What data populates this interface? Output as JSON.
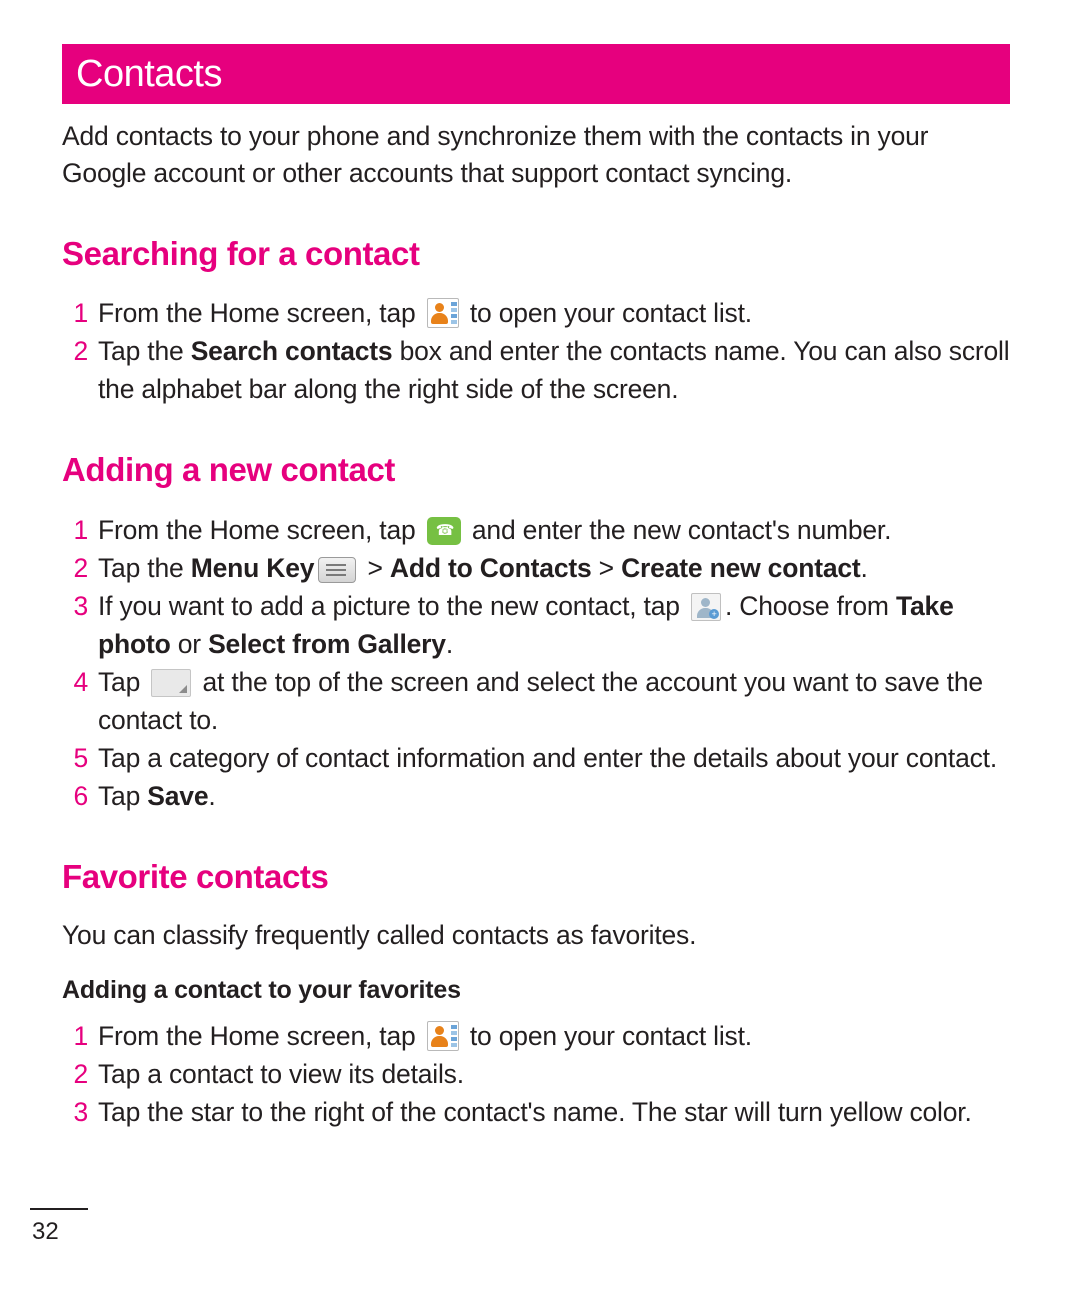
{
  "header": {
    "title": "Contacts",
    "accent_color": "#e6007e"
  },
  "intro": "Add contacts to your phone and synchronize them with the contacts in your Google account or other accounts that support contact syncing.",
  "sections": [
    {
      "heading": "Searching for a contact",
      "steps": [
        {
          "num": "1",
          "parts": [
            {
              "text": "From the Home screen, tap "
            },
            {
              "icon": "contacts-icon"
            },
            {
              "text": " to open your contact list."
            }
          ]
        },
        {
          "num": "2",
          "parts": [
            {
              "text": "Tap the "
            },
            {
              "text": "Search contacts",
              "bold": true
            },
            {
              "text": " box and enter the contacts name. You can also scroll the alphabet bar along the right side of the screen."
            }
          ]
        }
      ]
    },
    {
      "heading": "Adding a new contact",
      "steps": [
        {
          "num": "1",
          "parts": [
            {
              "text": "From the Home screen, tap "
            },
            {
              "icon": "phone-dial-icon"
            },
            {
              "text": " and enter the new contact's number."
            }
          ]
        },
        {
          "num": "2",
          "parts": [
            {
              "text": "Tap the "
            },
            {
              "text": "Menu Key",
              "bold": true
            },
            {
              "icon": "menu-key-icon"
            },
            {
              "text": " > "
            },
            {
              "text": "Add to Contacts",
              "bold": true
            },
            {
              "text": " > "
            },
            {
              "text": "Create new contact",
              "bold": true
            },
            {
              "text": "."
            }
          ]
        },
        {
          "num": "3",
          "parts": [
            {
              "text": "If you want to add a picture to the new contact, tap "
            },
            {
              "icon": "add-photo-icon"
            },
            {
              "text": ". Choose from "
            },
            {
              "text": "Take photo",
              "bold": true
            },
            {
              "text": " or "
            },
            {
              "text": "Select from Gallery",
              "bold": true
            },
            {
              "text": "."
            }
          ]
        },
        {
          "num": "4",
          "parts": [
            {
              "text": "Tap "
            },
            {
              "icon": "account-dropdown-icon"
            },
            {
              "text": " at the top of the screen and select the account you want to save the contact to."
            }
          ]
        },
        {
          "num": "5",
          "parts": [
            {
              "text": "Tap a category of contact information and enter the details about your contact."
            }
          ]
        },
        {
          "num": "6",
          "parts": [
            {
              "text": "Tap "
            },
            {
              "text": "Save",
              "bold": true
            },
            {
              "text": "."
            }
          ]
        }
      ]
    },
    {
      "heading": "Favorite contacts",
      "body": "You can classify frequently called contacts as favorites.",
      "subheading": "Adding a contact to your favorites",
      "steps": [
        {
          "num": "1",
          "parts": [
            {
              "text": "From the Home screen, tap "
            },
            {
              "icon": "contacts-icon"
            },
            {
              "text": " to open your contact list."
            }
          ]
        },
        {
          "num": "2",
          "parts": [
            {
              "text": "Tap a contact to view its details."
            }
          ]
        },
        {
          "num": "3",
          "parts": [
            {
              "text": "Tap the star to the right of the contact's name. The star will turn yellow color."
            }
          ]
        }
      ]
    }
  ],
  "footer": {
    "page_number": "32"
  }
}
